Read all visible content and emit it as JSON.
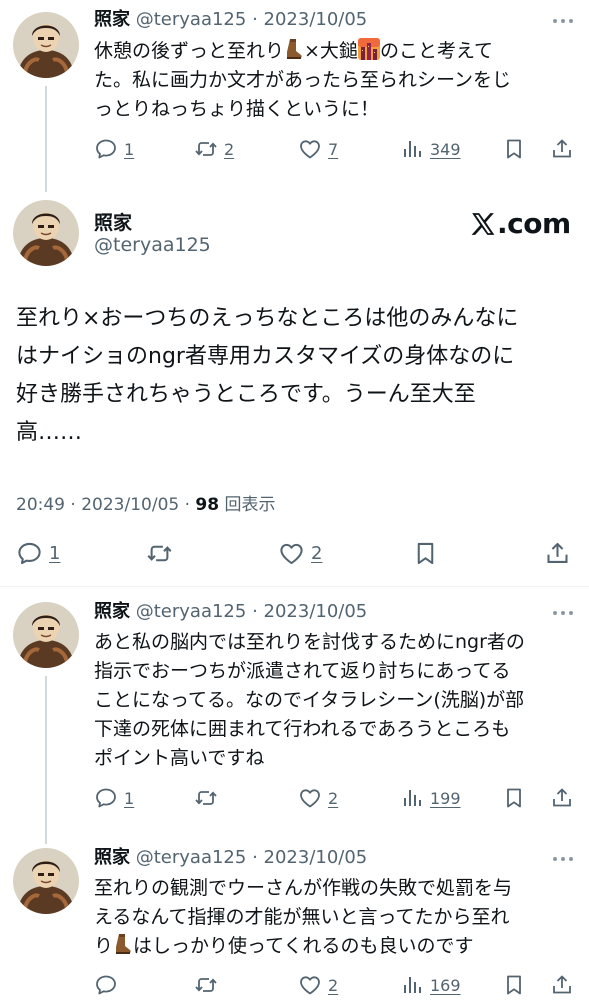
{
  "tweets_top": [
    {
      "name": "照家",
      "handle": "@teryaa125",
      "sep": " · ",
      "date": "2023/10/05",
      "text_a": "休憩の後ずっと至れり",
      "emoji_a": "boot-emoji",
      "text_b": "×大鎚",
      "emoji_b": "city-sunset-emoji",
      "text_c": "のこと考えて\nた。私に画力か文才があったら至られシーンをじ\nっとりねっちょり描くというに！",
      "replies": "1",
      "retweets": "2",
      "likes": "7",
      "views": "349"
    }
  ],
  "main": {
    "name": "照家",
    "handle": "@teryaa125",
    "brand": ".com",
    "text": "至れり×おーつちのえっちなところは他のみんなに\nはナイショのngr者専用カスタマイズの身体なのに\n好き勝手されちゃうところです。うーん至大至\n高……",
    "time": "20:49",
    "sep": " · ",
    "date": "2023/10/05",
    "sep2": " · ",
    "views_count": "98",
    "views_label": " 回表示",
    "replies": "1",
    "likes": "2"
  },
  "replies": [
    {
      "name": "照家",
      "handle": "@teryaa125",
      "sep": " · ",
      "date": "2023/10/05",
      "text": "あと私の脳内では至れりを討伐するためにngr者の\n指示でおーつちが派遣されて返り討ちにあってる\nことになってる。なのでイタラレシーン(洗脳)が部\n下達の死体に囲まれて行われるであろうところも\nポイント高いですね",
      "replies": "1",
      "likes": "2",
      "views": "199"
    },
    {
      "name": "照家",
      "handle": "@teryaa125",
      "sep": " · ",
      "date": "2023/10/05",
      "text_a": "至れりの観測でウーさんが作戦の失敗で処罰を与\nえるなんて指揮の才能が無いと言ってたから至れ\nり",
      "emoji_a": "boot-emoji",
      "text_b": "はしっかり使ってくれるのも良いのです",
      "likes": "2",
      "views": "169"
    }
  ],
  "colors": {
    "text": "#0f1419",
    "secondary": "#536471",
    "thread_line": "#cfd9de",
    "divider": "#eff3f4"
  }
}
